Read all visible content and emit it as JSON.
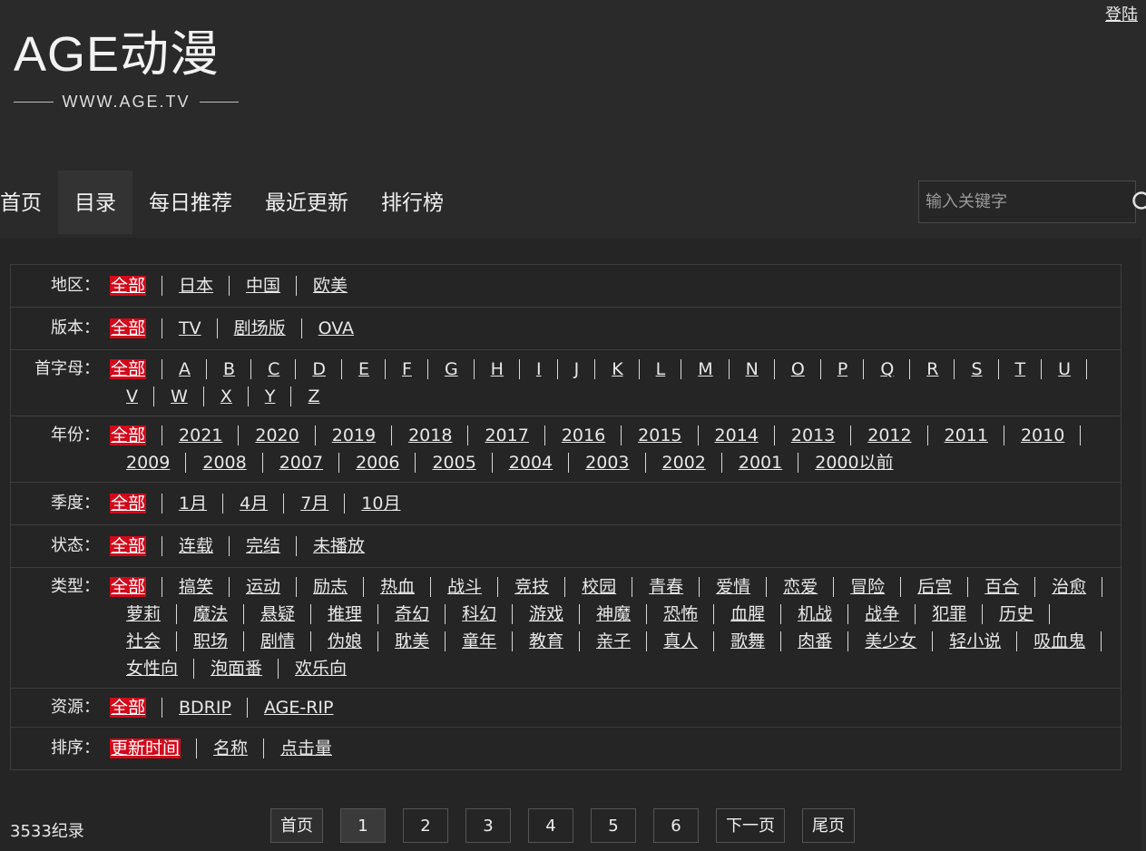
{
  "header": {
    "login_label": "登陆",
    "logo_text": "AGE动漫",
    "logo_sub": "WWW.AGE.TV"
  },
  "nav": [
    "首页",
    "目录",
    "每日推荐",
    "最近更新",
    "排行榜"
  ],
  "nav_active": "目录",
  "search": {
    "placeholder": "输入关键字",
    "value": "",
    "icon": "search-icon"
  },
  "filters": [
    {
      "label": "地区：",
      "items": [
        "全部",
        "日本",
        "中国",
        "欧美"
      ],
      "selected": "全部"
    },
    {
      "label": "版本：",
      "items": [
        "全部",
        "TV",
        "剧场版",
        "OVA"
      ],
      "selected": "全部"
    },
    {
      "label": "首字母：",
      "items": [
        "全部",
        "A",
        "B",
        "C",
        "D",
        "E",
        "F",
        "G",
        "H",
        "I",
        "J",
        "K",
        "L",
        "M",
        "N",
        "O",
        "P",
        "Q",
        "R",
        "S",
        "T",
        "U",
        "V",
        "W",
        "X",
        "Y",
        "Z"
      ],
      "selected": "全部"
    },
    {
      "label": "年份：",
      "items": [
        "全部",
        "2021",
        "2020",
        "2019",
        "2018",
        "2017",
        "2016",
        "2015",
        "2014",
        "2013",
        "2012",
        "2011",
        "2010",
        "2009",
        "2008",
        "2007",
        "2006",
        "2005",
        "2004",
        "2003",
        "2002",
        "2001",
        "2000以前"
      ],
      "selected": "全部"
    },
    {
      "label": "季度：",
      "items": [
        "全部",
        "1月",
        "4月",
        "7月",
        "10月"
      ],
      "selected": "全部"
    },
    {
      "label": "状态：",
      "items": [
        "全部",
        "连载",
        "完结",
        "未播放"
      ],
      "selected": "全部"
    },
    {
      "label": "类型：",
      "items": [
        "全部",
        "搞笑",
        "运动",
        "励志",
        "热血",
        "战斗",
        "竞技",
        "校园",
        "青春",
        "爱情",
        "恋爱",
        "冒险",
        "后宫",
        "百合",
        "治愈",
        "萝莉",
        "魔法",
        "悬疑",
        "推理",
        "奇幻",
        "科幻",
        "游戏",
        "神魔",
        "恐怖",
        "血腥",
        "机战",
        "战争",
        "犯罪",
        "历史",
        "社会",
        "职场",
        "剧情",
        "伪娘",
        "耽美",
        "童年",
        "教育",
        "亲子",
        "真人",
        "歌舞",
        "肉番",
        "美少女",
        "轻小说",
        "吸血鬼",
        "女性向",
        "泡面番",
        "欢乐向"
      ],
      "selected": "全部"
    },
    {
      "label": "资源：",
      "items": [
        "全部",
        "BDRIP",
        "AGE-RIP"
      ],
      "selected": "全部"
    },
    {
      "label": "排序：",
      "items": [
        "更新时间",
        "名称",
        "点击量"
      ],
      "selected": "更新时间"
    }
  ],
  "records": "3533纪录",
  "pagination": {
    "first": "首页",
    "pages": [
      "1",
      "2",
      "3",
      "4",
      "5",
      "6"
    ],
    "current": "1",
    "next": "下一页",
    "last": "尾页"
  },
  "colors": {
    "background": "#2a2a2a",
    "selected_bg": "#d3081a",
    "text": "#e8e8e8"
  }
}
